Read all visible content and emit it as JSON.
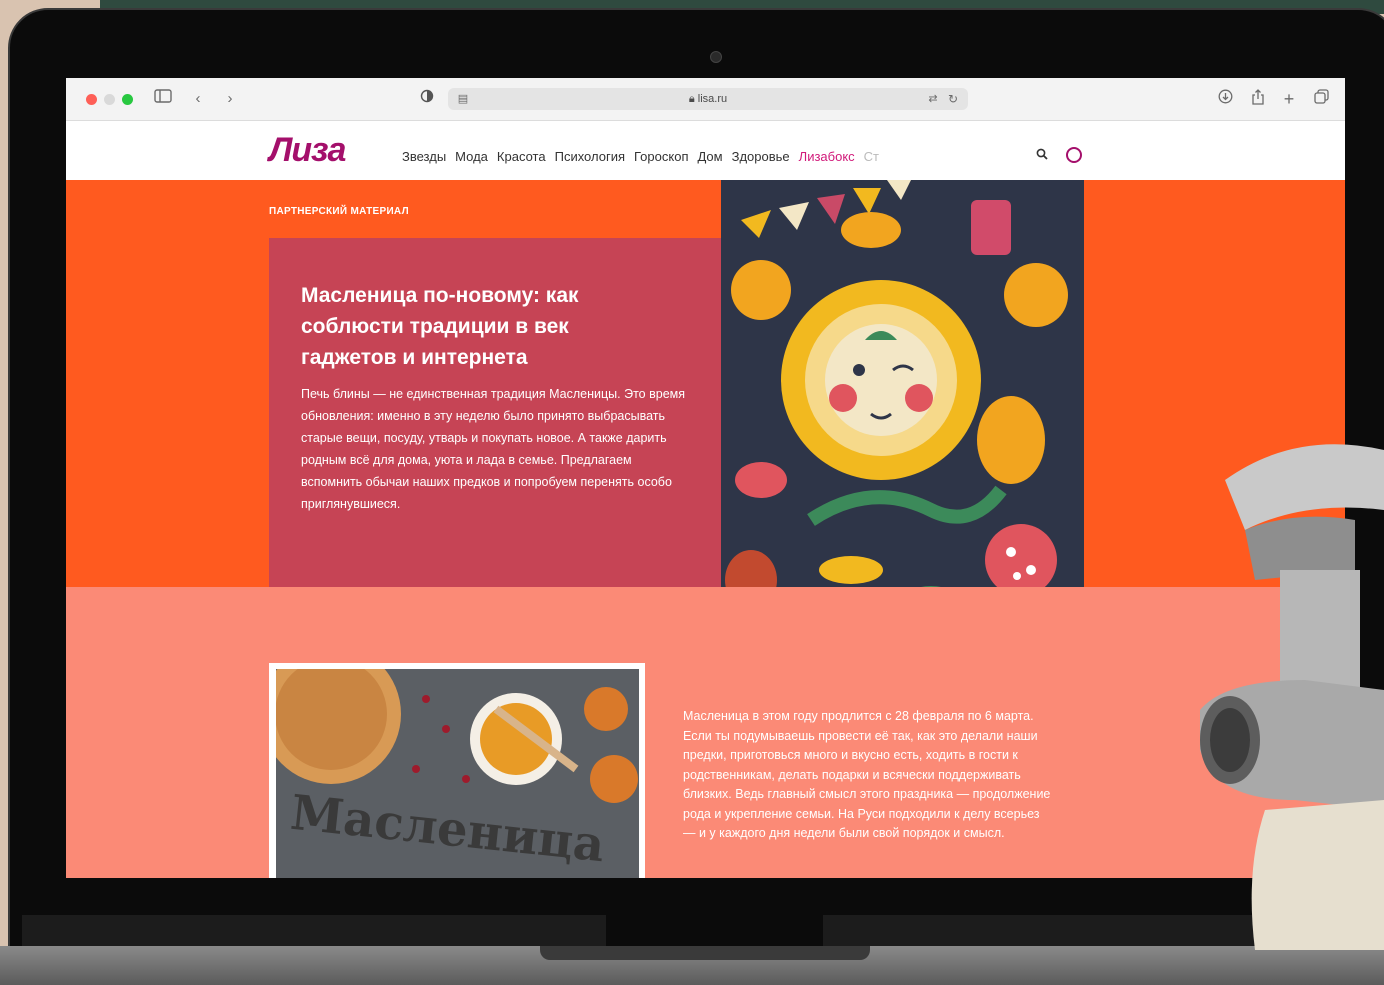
{
  "browser": {
    "url": "lisa.ru"
  },
  "site": {
    "logo": "Лиза",
    "nav": [
      "Звезды",
      "Мода",
      "Красота",
      "Психология",
      "Гороскоп",
      "Дом",
      "Здоровье",
      "Лизабокс",
      "Ст"
    ]
  },
  "hero": {
    "label": "ПАРТНЕРСКИЙ МАТЕРИАЛ",
    "title": "Масленица по-новому: как соблюсти традиции в век гаджетов и интернета",
    "lead": "Печь блины — не единственная традиция Масленицы. Это время обновления: именно в эту неделю было принято выбрасывать старые вещи, посуду, утварь и покупать новое. А также дарить родным всё для дома, уюта и лада в семье. Предлагаем вспомнить обычаи наших предков и попробуем перенять особо приглянувшиеся."
  },
  "article": {
    "photo_caption": "Масленица",
    "body": "Масленица в этом году продлится с 28 февраля по 6 марта. Если ты подумываешь провести её так, как это делали наши предки, приготовься много и вкусно есть, ходить в гости к родственникам, делать подарки и всячески поддерживать близких. Ведь главный смысл этого праздника — продолжение рода и укрепление семьи. На Руси подходили к делу всерьез — и у каждого дня недели были свой порядок и смысл."
  },
  "icons": {
    "sidebar": "sidebar-icon",
    "back": "chevron-left-icon",
    "forward": "chevron-right-icon",
    "shield": "privacy-shield-icon",
    "reader": "reader-icon",
    "lock": "lock-icon",
    "translate": "translate-icon",
    "reload": "reload-icon",
    "download": "download-icon",
    "share": "share-icon",
    "new_tab": "plus-icon",
    "tabs": "tabs-overview-icon",
    "search": "search-icon",
    "user": "user-icon"
  },
  "colors": {
    "brand": "#a40f6b",
    "hero_bg": "#ff5a1f",
    "card_bg": "#c64455",
    "lower_bg": "#fb8a76",
    "nav_active": "#d11a7a"
  }
}
